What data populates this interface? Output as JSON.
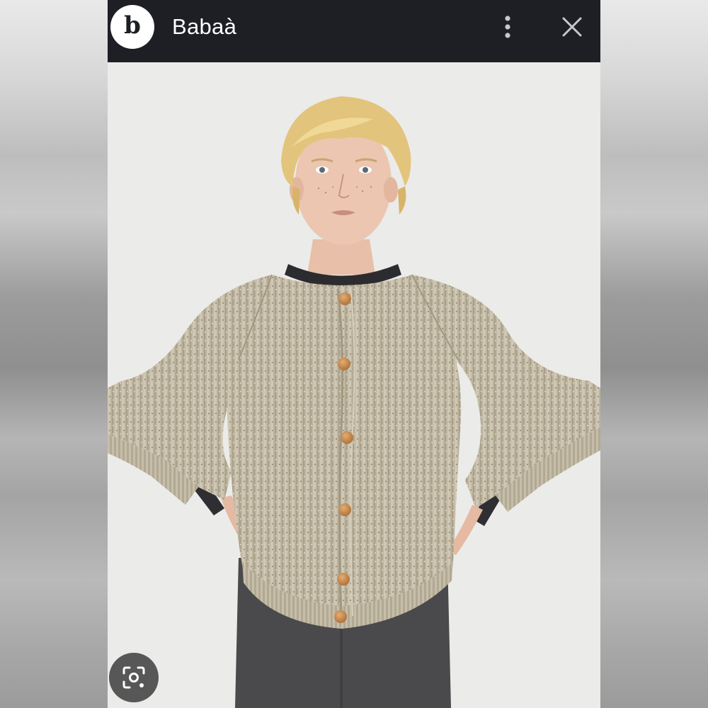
{
  "header": {
    "logo_letter": "b",
    "title": "Babaà",
    "more_icon": "more-vert-icon",
    "close_icon": "close-icon"
  },
  "image": {
    "subject": "model-wearing-chunky-knit-cardigan",
    "lens_icon": "visual-search-icon"
  },
  "colors": {
    "topbar": "#1d1f25",
    "sweater": "#bdb49f",
    "buttons": "#c8884a",
    "trousers": "#4a4a4c"
  }
}
